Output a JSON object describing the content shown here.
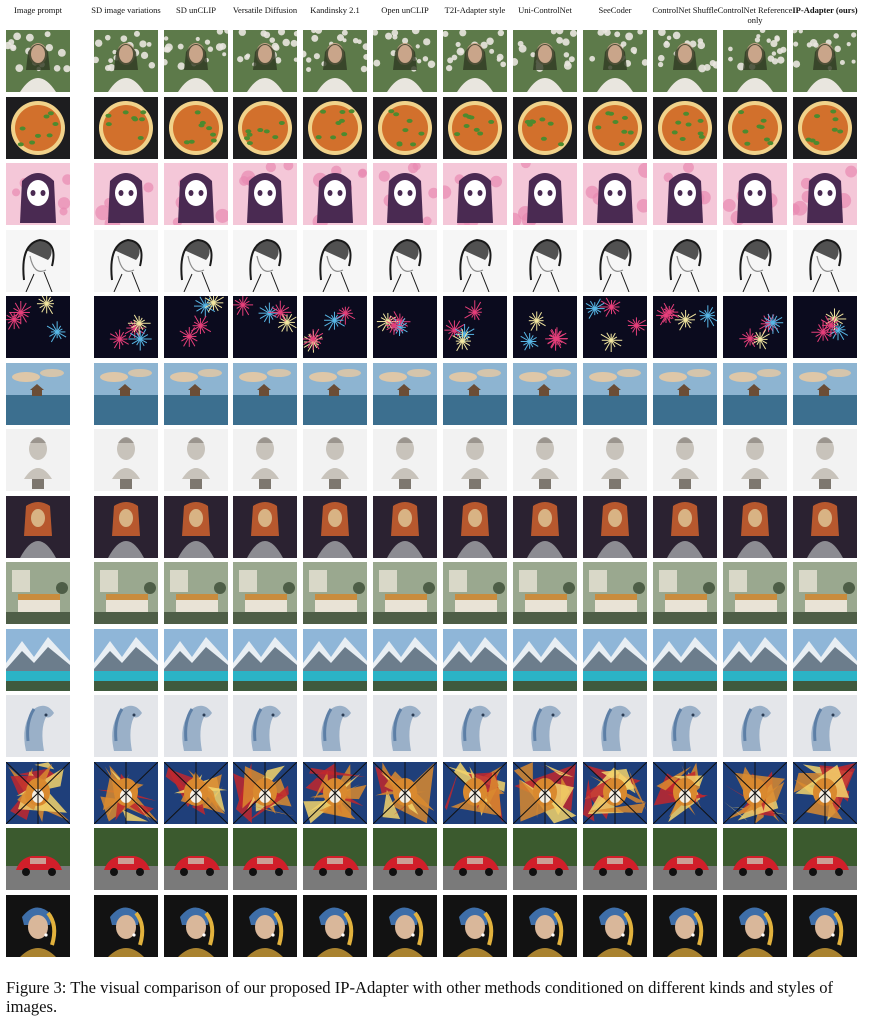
{
  "columns": [
    {
      "label": "Image prompt",
      "bold": false
    },
    {
      "label": "SD image variations",
      "bold": false
    },
    {
      "label": "SD unCLIP",
      "bold": false
    },
    {
      "label": "Versatile Diffusion",
      "bold": false
    },
    {
      "label": "Kandinsky 2.1",
      "bold": false
    },
    {
      "label": "Open unCLIP",
      "bold": false
    },
    {
      "label": "T2I-Adapter style",
      "bold": false
    },
    {
      "label": "Uni-ControlNet",
      "bold": false
    },
    {
      "label": "SeeCoder",
      "bold": false
    },
    {
      "label": "ControlNet Shuffle",
      "bold": false
    },
    {
      "label": "ControlNet Reference only",
      "bold": false
    },
    {
      "label": "IP-Adapter (ours)",
      "bold": true
    }
  ],
  "rows": [
    {
      "subject": "woman-in-flower-garden",
      "palette": [
        "#5d7a4a",
        "#e9e6df",
        "#c9a58a",
        "#2f3a22"
      ]
    },
    {
      "subject": "pizza",
      "palette": [
        "#1d1d1f",
        "#d2702c",
        "#4d8a2f",
        "#f1d28a"
      ]
    },
    {
      "subject": "anime-girl",
      "palette": [
        "#f4c7d8",
        "#4a2a52",
        "#e88ab2",
        "#ffffff"
      ]
    },
    {
      "subject": "sketch-portrait",
      "palette": [
        "#f6f6f6",
        "#1a1a1a",
        "#8c8c8c",
        "#ffffff"
      ]
    },
    {
      "subject": "fireworks",
      "palette": [
        "#0b0b1e",
        "#e63f7a",
        "#58b7e6",
        "#f2e6a0"
      ]
    },
    {
      "subject": "lake-house",
      "palette": [
        "#8db4d1",
        "#e7c9a3",
        "#3c6f8f",
        "#6b4d36"
      ]
    },
    {
      "subject": "marble-bust",
      "palette": [
        "#f2f2f2",
        "#c8c3bb",
        "#7d776f",
        "#ffffff"
      ]
    },
    {
      "subject": "armored-woman",
      "palette": [
        "#2b2231",
        "#b7582e",
        "#8c8c92",
        "#d8b384"
      ]
    },
    {
      "subject": "bedroom",
      "palette": [
        "#9aa88f",
        "#e9e3d6",
        "#c98c3e",
        "#4e5e47"
      ]
    },
    {
      "subject": "mountain-lake",
      "palette": [
        "#8fb6d8",
        "#2bb3c6",
        "#3f5a3e",
        "#e8eef3"
      ]
    },
    {
      "subject": "horse-painting",
      "palette": [
        "#e4e6ea",
        "#5d7fa6",
        "#9ab0c8",
        "#2b3d55"
      ]
    },
    {
      "subject": "stained-glass-dog",
      "palette": [
        "#1f3f7a",
        "#d9892f",
        "#c1272d",
        "#f3d36b"
      ]
    },
    {
      "subject": "red-car",
      "palette": [
        "#3b5a2e",
        "#d11f2a",
        "#7a7a7a",
        "#c9d6c3"
      ]
    },
    {
      "subject": "girl-with-pearl-earring",
      "palette": [
        "#121212",
        "#3e6ea8",
        "#e2b23d",
        "#d9b79a"
      ]
    }
  ],
  "caption": "Figure 3: The visual comparison of our proposed IP-Adapter with other methods conditioned on different kinds and styles of images."
}
